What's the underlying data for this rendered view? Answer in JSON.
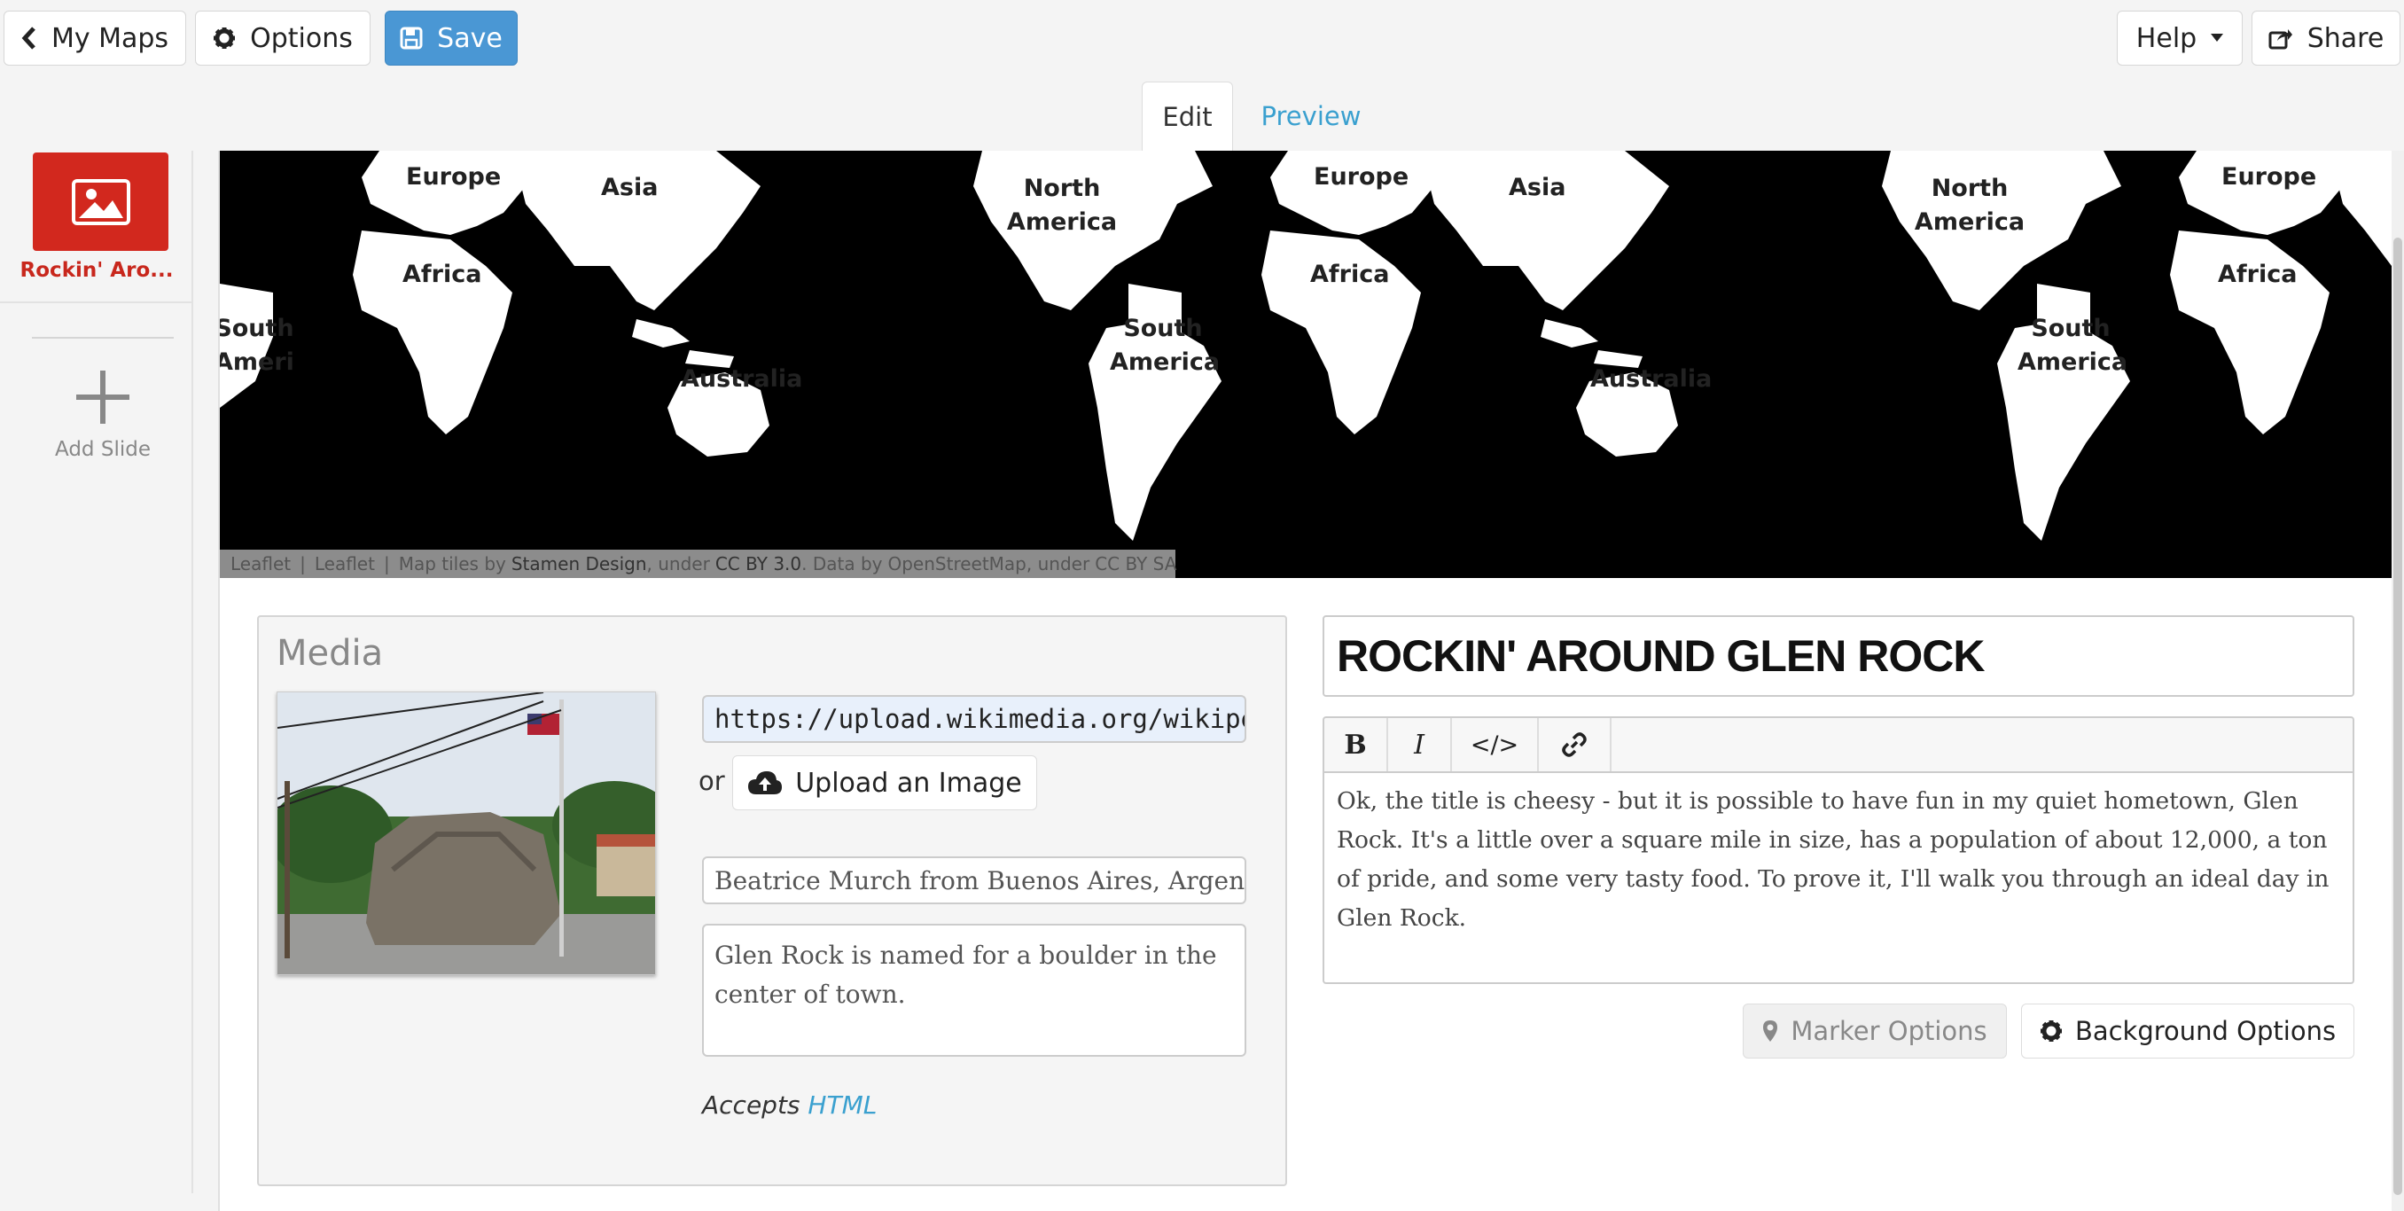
{
  "topbar": {
    "my_maps_label": "My Maps",
    "options_label": "Options",
    "save_label": "Save",
    "help_label": "Help",
    "share_label": "Share"
  },
  "tabs": {
    "edit_label": "Edit",
    "preview_label": "Preview"
  },
  "sidebar": {
    "slides": [
      {
        "label": "Rockin' Aro..."
      }
    ],
    "add_slide_label": "Add Slide"
  },
  "map": {
    "labels": {
      "europe": "Europe",
      "asia": "Asia",
      "africa": "Africa",
      "north_america": "North America",
      "south_america": "South America",
      "australia": "Australia"
    },
    "attribution": {
      "leaflet1": "Leaflet",
      "leaflet2": "Leaflet",
      "tiles_prefix": "Map tiles by",
      "tiles_by": "Stamen Design",
      "under1": ", under",
      "license1": "CC BY 3.0",
      "data_prefix": ". Data by",
      "data_by": "OpenStreetMap",
      "under2": ", under",
      "license2": "CC BY SA"
    }
  },
  "media": {
    "title": "Media",
    "url_value": "https://upload.wikimedia.org/wikipedia",
    "or_label": "or",
    "upload_label": "Upload an Image",
    "credit_value": "Beatrice Murch from Buenos Aires, Argentina",
    "caption_value": "Glen Rock is named for a boulder in the center of town.",
    "accepts_prefix": "Accepts",
    "accepts_link": "HTML"
  },
  "slide": {
    "title": "ROCKIN' AROUND GLEN ROCK",
    "toolbar": {
      "bold": "B",
      "italic": "I",
      "code": "</>"
    },
    "body": "Ok, the title is cheesy - but it is possible to have fun in my quiet hometown, Glen Rock. It's a little over a square mile in size, has a population of about 12,000, a ton of pride, and some very tasty food. To prove it, I'll walk you through an ideal day in Glen Rock.",
    "marker_options_label": "Marker Options",
    "background_options_label": "Background Options"
  },
  "colors": {
    "accent": "#4a97d4",
    "slide_red": "#d2281e",
    "link": "#3aa0cf"
  }
}
